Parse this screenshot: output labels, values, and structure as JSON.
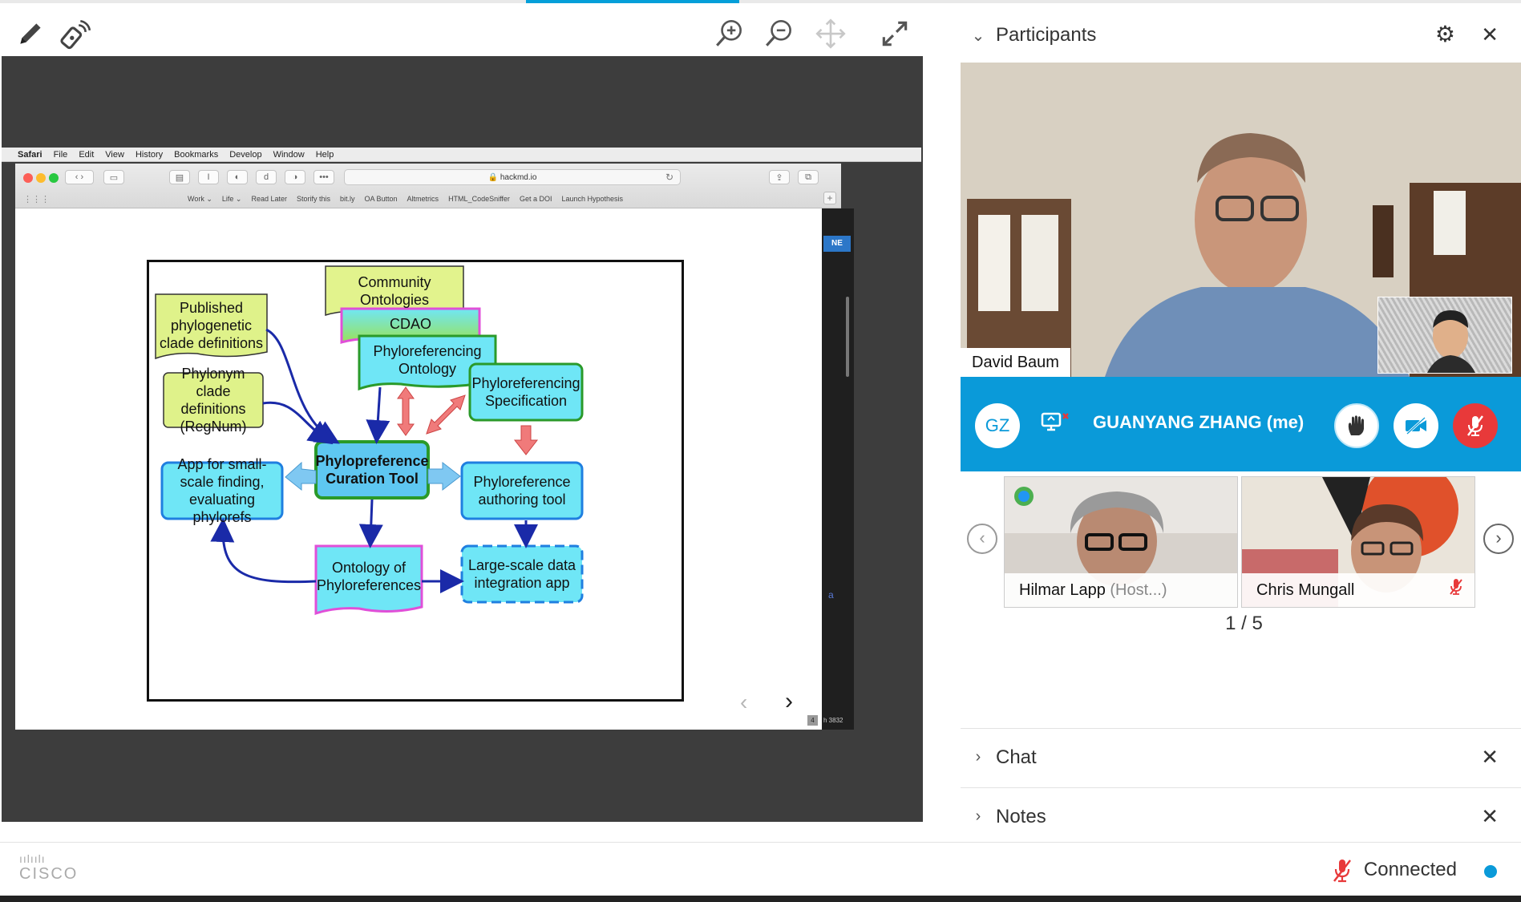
{
  "toolbar": {
    "annotate_icon": "pencil-icon",
    "pointer_icon": "pointer-icon",
    "zoom_in_icon": "zoom-in-icon",
    "zoom_out_icon": "zoom-out-icon",
    "pan_icon": "move-icon",
    "fullscreen_icon": "fullscreen-icon"
  },
  "mac_menu": {
    "apple": "",
    "items": [
      "Safari",
      "File",
      "Edit",
      "View",
      "History",
      "Bookmarks",
      "Develop",
      "Window",
      "Help"
    ]
  },
  "safari": {
    "url": "🔒 hackmd.io",
    "bookmarks": [
      "Work ⌄",
      "Life ⌄",
      "Read Later",
      "Storify this",
      "bit.ly",
      "OA Button",
      "Altmetrics",
      "HTML_CodeSniffer",
      "Get a DOI",
      "Launch Hypothesis"
    ],
    "side_button": "NE",
    "side_letter": "a",
    "page_num": "4",
    "footer_text": "h 3832"
  },
  "slide": {
    "nodes": {
      "community": "Community Ontologies",
      "cdao": "CDAO",
      "phyloref_ontology": "Phyloreferencing Ontology",
      "published": "Published phylogenetic clade definitions",
      "phylonym": "Phylonym clade definitions (RegNum)",
      "spec": "Phyloreferencing Specification",
      "curation": "Phylopreference Curation Tool",
      "app_small": "App for small-scale finding, evaluating phylorefs",
      "authoring": "Phyloreference authoring tool",
      "ontology_phylo": "Ontology of Phyloreferences",
      "large_scale": "Large-scale data integration app"
    },
    "prev": "‹",
    "next": "›"
  },
  "participants_panel": {
    "title": "Participants",
    "speaker_name": "David Baum",
    "me": {
      "initials": "GZ",
      "name": "GUANYANG ZHANG (me)"
    },
    "thumbnails": [
      {
        "name": "Hilmar Lapp",
        "role": "(Host...)"
      },
      {
        "name": "Chris Mungall",
        "role": ""
      }
    ],
    "page_indicator": "1 / 5"
  },
  "chat_panel": {
    "title": "Chat"
  },
  "notes_panel": {
    "title": "Notes"
  },
  "status": {
    "logo": "CISCO",
    "connection": "Connected"
  },
  "colors": {
    "accent": "#0a9ad9",
    "mute_red": "#e8393a",
    "slide_yellow": "#dff28a",
    "slide_cyan": "#6fe6f6",
    "slide_blue_box": "#5ec7f1",
    "slide_green_border": "#2a9a2a",
    "slide_magenta": "#e04fd8"
  }
}
